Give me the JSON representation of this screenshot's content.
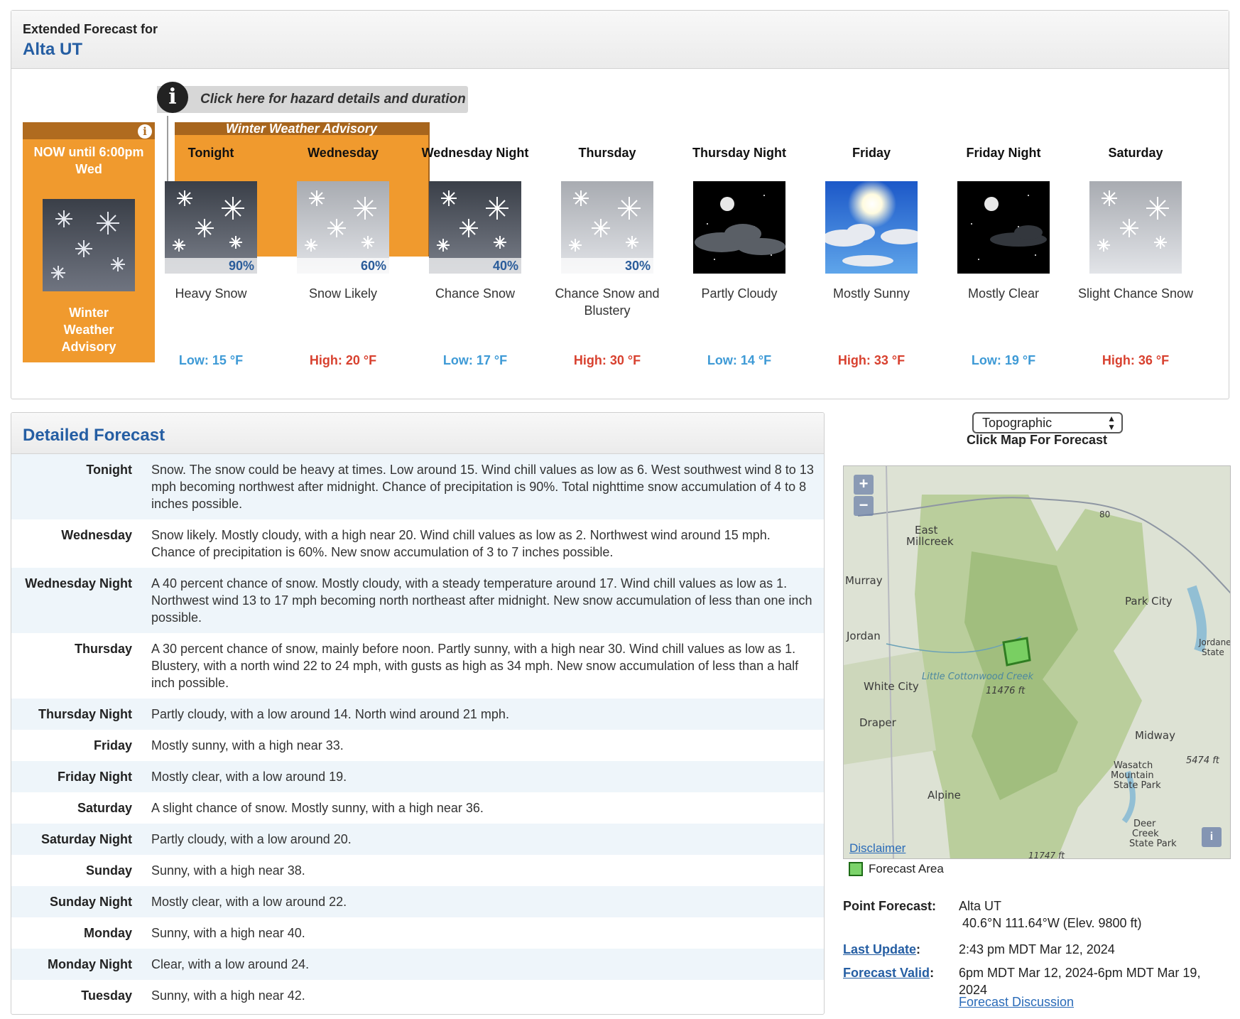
{
  "header": {
    "subtitle": "Extended Forecast for",
    "location": "Alta UT"
  },
  "hazard": {
    "link_text": "Click here for hazard details and duration",
    "icon": "info-icon"
  },
  "now": {
    "title": "NOW until 6:00pm Wed",
    "label": "Winter Weather Advisory"
  },
  "advisory": {
    "label": "Winter Weather Advisory"
  },
  "periods": [
    {
      "name": "Tonight",
      "pop": "90%",
      "desc": "Heavy Snow",
      "temp": "Low: 15 °F",
      "kind": "low",
      "icon": "snow-dark"
    },
    {
      "name": "Wednesday",
      "pop": "60%",
      "desc": "Snow Likely",
      "temp": "High: 20 °F",
      "kind": "high",
      "icon": "snow-light"
    },
    {
      "name": "Wednesday Night",
      "pop": "40%",
      "desc": "Chance Snow",
      "temp": "Low: 17 °F",
      "kind": "low",
      "icon": "snow-dark"
    },
    {
      "name": "Thursday",
      "pop": "30%",
      "desc": "Chance Snow and Blustery",
      "temp": "High: 30 °F",
      "kind": "high",
      "icon": "snow-light"
    },
    {
      "name": "Thursday Night",
      "pop": "",
      "desc": "Partly Cloudy",
      "temp": "Low: 14 °F",
      "kind": "low",
      "icon": "night-partly-cloudy"
    },
    {
      "name": "Friday",
      "pop": "",
      "desc": "Mostly Sunny",
      "temp": "High: 33 °F",
      "kind": "high",
      "icon": "sunny"
    },
    {
      "name": "Friday Night",
      "pop": "",
      "desc": "Mostly Clear",
      "temp": "Low: 19 °F",
      "kind": "low",
      "icon": "night-clear"
    },
    {
      "name": "Saturday",
      "pop": "",
      "desc": "Slight Chance Snow",
      "temp": "High: 36 °F",
      "kind": "high",
      "icon": "snow-light"
    }
  ],
  "detailed": {
    "title": "Detailed Forecast",
    "rows": [
      {
        "label": "Tonight",
        "text": "Snow. The snow could be heavy at times. Low around 15. Wind chill values as low as 6. West southwest wind 8 to 13 mph becoming northwest after midnight. Chance of precipitation is 90%. Total nighttime snow accumulation of 4 to 8 inches possible."
      },
      {
        "label": "Wednesday",
        "text": "Snow likely. Mostly cloudy, with a high near 20. Wind chill values as low as 2. Northwest wind around 15 mph. Chance of precipitation is 60%. New snow accumulation of 3 to 7 inches possible."
      },
      {
        "label": "Wednesday Night",
        "text": "A 40 percent chance of snow. Mostly cloudy, with a steady temperature around 17. Wind chill values as low as 1. Northwest wind 13 to 17 mph becoming north northeast after midnight. New snow accumulation of less than one inch possible."
      },
      {
        "label": "Thursday",
        "text": "A 30 percent chance of snow, mainly before noon. Partly sunny, with a high near 30. Wind chill values as low as 1. Blustery, with a north wind 22 to 24 mph, with gusts as high as 34 mph. New snow accumulation of less than a half inch possible."
      },
      {
        "label": "Thursday Night",
        "text": "Partly cloudy, with a low around 14. North wind around 21 mph."
      },
      {
        "label": "Friday",
        "text": "Mostly sunny, with a high near 33."
      },
      {
        "label": "Friday Night",
        "text": "Mostly clear, with a low around 19."
      },
      {
        "label": "Saturday",
        "text": "A slight chance of snow. Mostly sunny, with a high near 36."
      },
      {
        "label": "Saturday Night",
        "text": "Partly cloudy, with a low around 20."
      },
      {
        "label": "Sunday",
        "text": "Sunny, with a high near 38."
      },
      {
        "label": "Sunday Night",
        "text": "Mostly clear, with a low around 22."
      },
      {
        "label": "Monday",
        "text": "Sunny, with a high near 40."
      },
      {
        "label": "Monday Night",
        "text": "Clear, with a low around 24."
      },
      {
        "label": "Tuesday",
        "text": "Sunny, with a high near 42."
      }
    ]
  },
  "map": {
    "select_value": "Topographic",
    "hint": "Click Map For Forecast",
    "zoom_in": "+",
    "zoom_out": "−",
    "disclaimer": "Disclaimer",
    "info": "i",
    "legend": "Forecast Area",
    "labels": [
      "East Millcreek",
      "Murray",
      "Jordan",
      "White City",
      "Draper",
      "Alpine",
      "Park City",
      "Midway",
      "Wasatch Mountain State Park",
      "Deer Creek State Park",
      "Little Cottonwood Creek",
      "11476 ft",
      "5474 ft",
      "11747 ft",
      "80",
      "Jordanelle State"
    ]
  },
  "meta": {
    "point_label": "Point Forecast:",
    "point_value": "Alta UT",
    "point_coords": "40.6°N 111.64°W (Elev. 9800 ft)",
    "update_label": "Last Update",
    "update_value": "2:43 pm MDT Mar 12, 2024",
    "valid_label": "Forecast Valid",
    "valid_value": "6pm MDT Mar 12, 2024-6pm MDT Mar 19, 2024",
    "discussion": "Forecast Discussion"
  },
  "colors": {
    "accent": "#255ea3",
    "advisory": "#f09a2e",
    "advisory_dark": "#b06b1f",
    "low": "#3e9ad6",
    "high": "#d8412f"
  }
}
